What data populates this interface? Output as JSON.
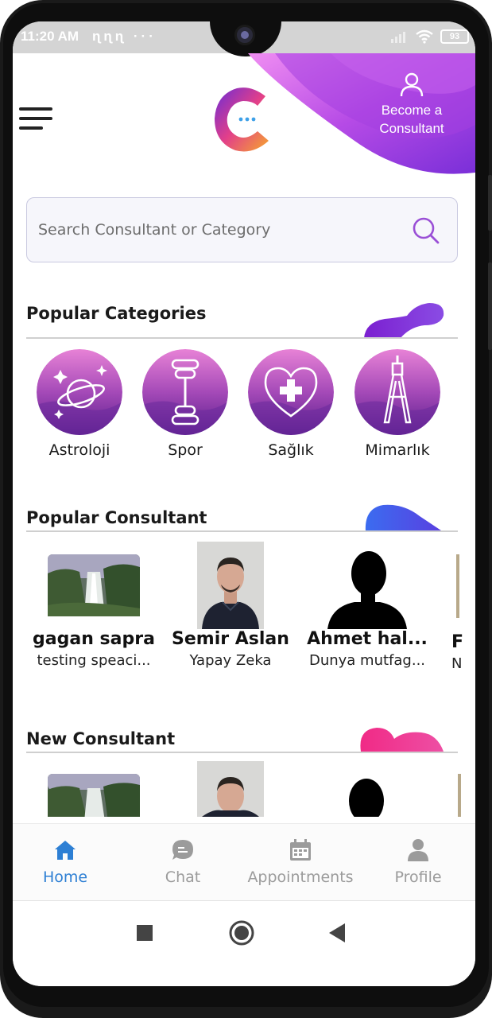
{
  "status_bar": {
    "time": "11:20 AM",
    "notification_glyphs": "ɳɳɳ ···",
    "battery": "93"
  },
  "header": {
    "menu_icon": "hamburger-menu-icon",
    "logo": "chat-bubble-logo",
    "become_consultant_label_line1": "Become a",
    "become_consultant_label_line2": "Consultant",
    "accent_colors": [
      "#b44de6",
      "#7b2fd6",
      "#e37be8"
    ]
  },
  "search": {
    "placeholder": "Search Consultant or Category",
    "value": ""
  },
  "popular_categories": {
    "title": "Popular Categories",
    "items": [
      {
        "label": "Astroloji",
        "icon": "planet-stars-icon"
      },
      {
        "label": "Spor",
        "icon": "dumbbell-icon"
      },
      {
        "label": "Sağlık",
        "icon": "heart-plus-icon"
      },
      {
        "label": "Mimarlık",
        "icon": "compass-drafting-icon"
      }
    ]
  },
  "popular_consultant": {
    "title": "Popular Consultant",
    "items": [
      {
        "name": "gagan sapra",
        "category": "testing speaci...",
        "image": "waterfall-photo"
      },
      {
        "name": "Semir Aslan",
        "category": "Yapay Zeka",
        "image": "man-portrait-photo"
      },
      {
        "name": "Ahmet hal...",
        "category": "Dunya mutfag...",
        "image": "silhouette-avatar"
      },
      {
        "name": "F",
        "category": "N",
        "image": "partial-photo"
      }
    ]
  },
  "new_consultant": {
    "title": "New Consultant"
  },
  "bottom_nav": {
    "items": [
      {
        "label": "Home",
        "icon": "home-icon",
        "active": true
      },
      {
        "label": "Chat",
        "icon": "chat-bubble-icon",
        "active": false
      },
      {
        "label": "Appointments",
        "icon": "calendar-icon",
        "active": false
      },
      {
        "label": "Profile",
        "icon": "person-icon",
        "active": false
      }
    ],
    "active_color": "#2d7fd4",
    "inactive_color": "#9b9b9b"
  },
  "system_nav": {
    "recent_icon": "square-recent-apps-icon",
    "home_icon": "circle-home-icon",
    "back_icon": "triangle-back-icon"
  }
}
